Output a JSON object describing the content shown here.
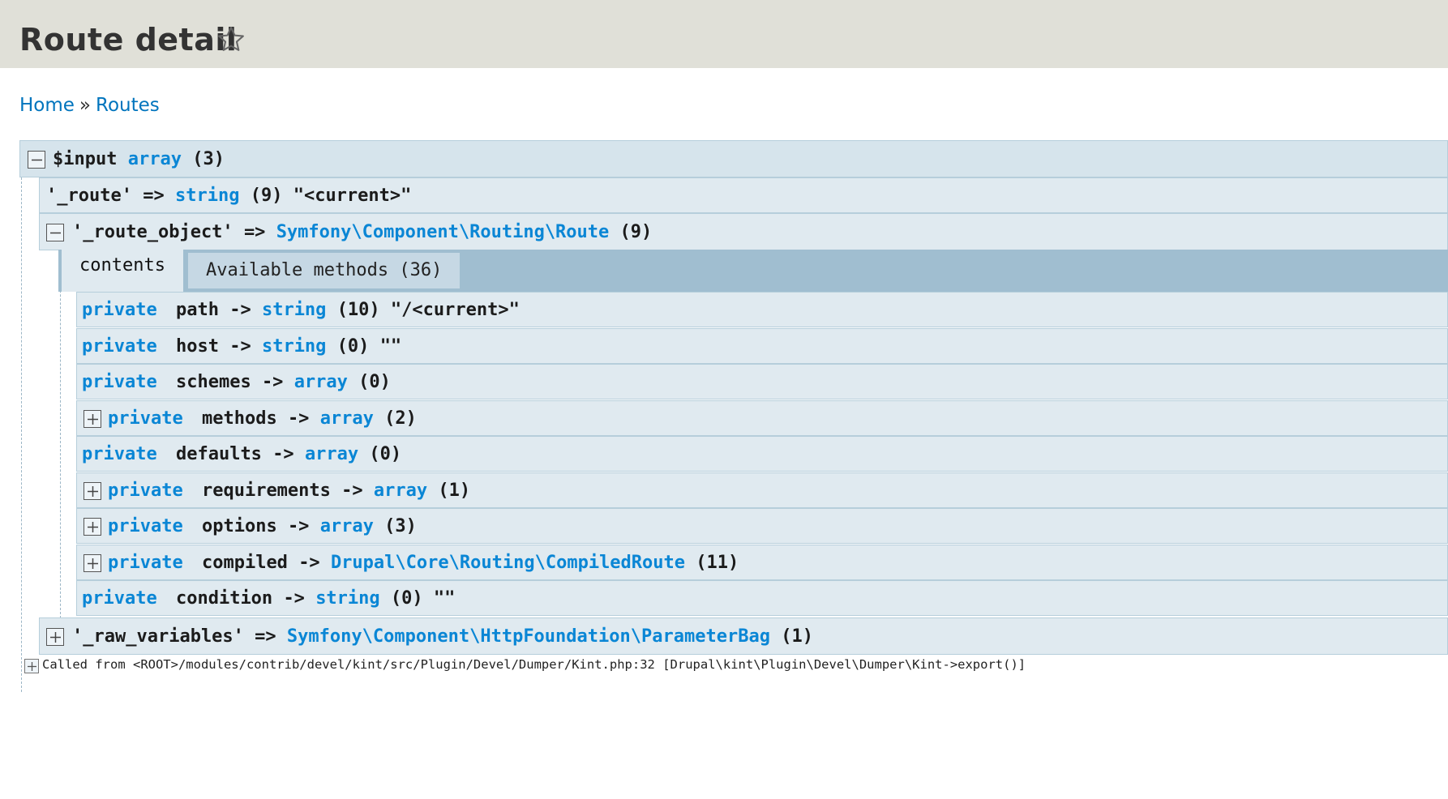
{
  "header": {
    "title": "Route detail"
  },
  "breadcrumb": {
    "home": "Home",
    "separator": "»",
    "routes": "Routes"
  },
  "dump": {
    "root": {
      "name": "$input",
      "type": "array",
      "count": "(3)"
    },
    "route": {
      "key": "'_route'",
      "arrow": "=>",
      "type": "string",
      "count": "(9)",
      "value": "\"<current>\""
    },
    "route_object": {
      "key": "'_route_object'",
      "arrow": "=>",
      "type": "Symfony\\Component\\Routing\\Route",
      "count": "(9)"
    },
    "tabs": {
      "contents": "contents",
      "methods": "Available methods (36)"
    },
    "properties": [
      {
        "visibility": "private",
        "name": "path",
        "arrow": "->",
        "type": "string",
        "count": "(10)",
        "value": "\"/<current>\"",
        "expandable": false
      },
      {
        "visibility": "private",
        "name": "host",
        "arrow": "->",
        "type": "string",
        "count": "(0)",
        "value": "\"\"",
        "expandable": false
      },
      {
        "visibility": "private",
        "name": "schemes",
        "arrow": "->",
        "type": "array",
        "count": "(0)",
        "value": "",
        "expandable": false
      },
      {
        "visibility": "private",
        "name": "methods",
        "arrow": "->",
        "type": "array",
        "count": "(2)",
        "value": "",
        "expandable": true
      },
      {
        "visibility": "private",
        "name": "defaults",
        "arrow": "->",
        "type": "array",
        "count": "(0)",
        "value": "",
        "expandable": false
      },
      {
        "visibility": "private",
        "name": "requirements",
        "arrow": "->",
        "type": "array",
        "count": "(1)",
        "value": "",
        "expandable": true
      },
      {
        "visibility": "private",
        "name": "options",
        "arrow": "->",
        "type": "array",
        "count": "(3)",
        "value": "",
        "expandable": true
      },
      {
        "visibility": "private",
        "name": "compiled",
        "arrow": "->",
        "type": "Drupal\\Core\\Routing\\CompiledRoute",
        "count": "(11)",
        "value": "",
        "expandable": true
      },
      {
        "visibility": "private",
        "name": "condition",
        "arrow": "->",
        "type": "string",
        "count": "(0)",
        "value": "\"\"",
        "expandable": false
      }
    ],
    "raw_variables": {
      "key": "'_raw_variables'",
      "arrow": "=>",
      "type": "Symfony\\Component\\HttpFoundation\\ParameterBag",
      "count": "(1)"
    },
    "called_from": "Called from <ROOT>/modules/contrib/devel/kint/src/Plugin/Devel/Dumper/Kint.php:32 [Drupal\\kint\\Plugin\\Devel\\Dumper\\Kint->export()]"
  },
  "colors": {
    "keyword": "#0a86d5",
    "row_bg": "#e0eaf0",
    "header_bg": "#e0e0d8",
    "link": "#0074bd"
  },
  "icons": [
    "star-icon",
    "collapse-icon",
    "expand-icon"
  ]
}
